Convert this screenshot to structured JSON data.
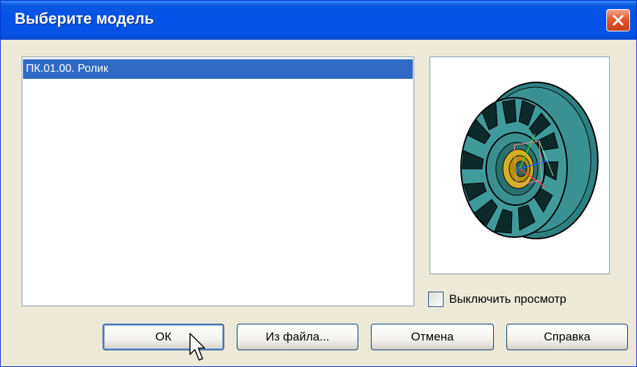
{
  "window": {
    "title": "Выберите модель"
  },
  "models_list": {
    "items": [
      {
        "label": "ПК.01.00. Ролик",
        "selected": true
      }
    ]
  },
  "preview": {
    "disable_label": "Выключить просмотр",
    "disabled": false
  },
  "buttons": {
    "ok": "ОК",
    "from_file": "Из файла...",
    "cancel": "Отмена",
    "help": "Справка"
  },
  "colors": {
    "titlebar": "#0553e6",
    "selection": "#316ac5",
    "model": "#3f9a9a"
  },
  "icons": {
    "close": "close-icon",
    "cursor": "mouse-pointer-icon"
  }
}
